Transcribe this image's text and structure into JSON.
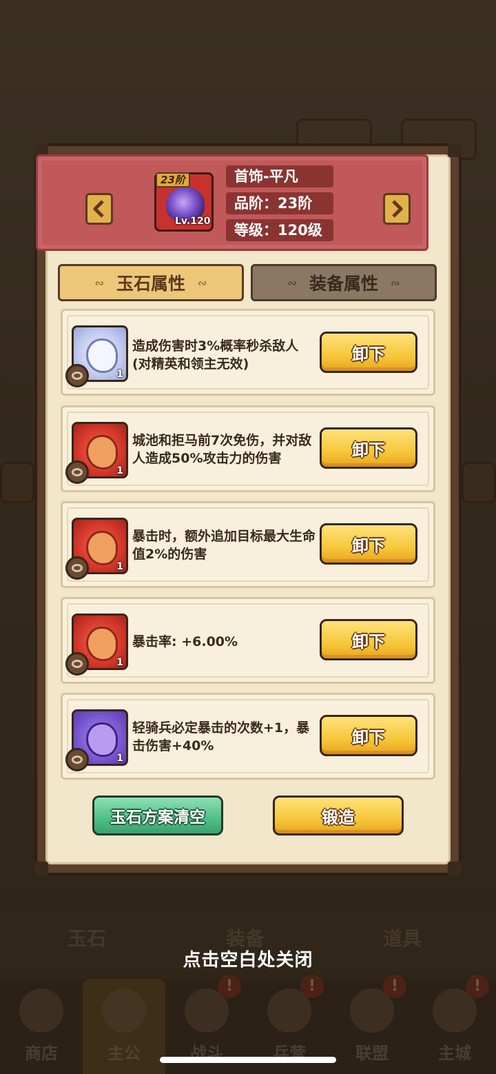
{
  "header": {
    "item_tier_badge": "23阶",
    "item_level_badge": "Lv.120",
    "item_name": "首饰-平凡",
    "quality": "品阶：23阶",
    "level": "等级：120级"
  },
  "tabs": [
    {
      "label": "玉石属性",
      "active": true
    },
    {
      "label": "装备属性",
      "active": false
    }
  ],
  "gems": [
    {
      "color": "white",
      "count": "1",
      "description": "造成伤害时3%概率秒杀敌人(对精英和领主无效)",
      "button": "卸下"
    },
    {
      "color": "red",
      "count": "1",
      "description": "城池和拒马前7次免伤，并对敌人造成50%攻击力的伤害",
      "button": "卸下"
    },
    {
      "color": "red",
      "count": "1",
      "description": "暴击时，额外追加目标最大生命值2%的伤害",
      "button": "卸下"
    },
    {
      "color": "red",
      "count": "1",
      "description": "暴击率: +6.00%",
      "button": "卸下"
    },
    {
      "color": "purple",
      "count": "1",
      "description": "轻骑兵必定暴击的次数+1，暴击伤害+40%",
      "button": "卸下"
    }
  ],
  "actions": {
    "clear_plan": "玉石方案清空",
    "forge": "锻造"
  },
  "close_hint": "点击空白处关闭",
  "background": {
    "inventory_tabs": [
      "玉石",
      "装备",
      "道具"
    ],
    "nav": [
      {
        "label": "商店",
        "icon": "shop-icon"
      },
      {
        "label": "主公",
        "icon": "lord-icon",
        "active": true
      },
      {
        "label": "战斗",
        "icon": "battle-icon"
      },
      {
        "label": "兵营",
        "icon": "barracks-icon"
      },
      {
        "label": "联盟",
        "icon": "alliance-icon"
      },
      {
        "label": "主城",
        "icon": "city-icon"
      }
    ],
    "badge": "!"
  },
  "colors": {
    "banner": "#c1585a",
    "button_yellow": "#f7c73a",
    "button_green": "#4fbf86",
    "panel": "#f2e6cb"
  }
}
